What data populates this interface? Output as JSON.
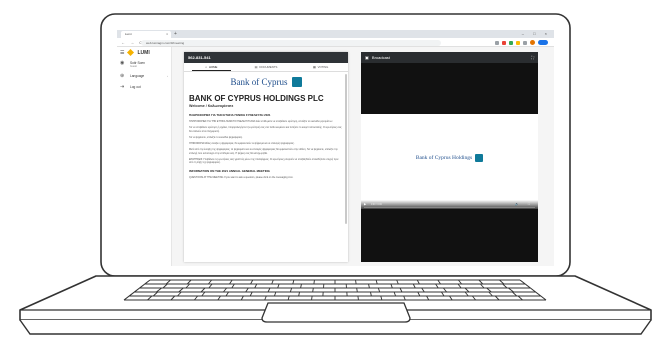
{
  "browser": {
    "tab_title": "Lumi",
    "tab_close": "×",
    "new_tab": "+",
    "window_controls": "–  □  ×",
    "nav_buttons": "← → C",
    "url": "web.lumiagm.com/#/meeting",
    "ext_icons": [
      "puzzle-icon",
      "star-icon",
      "extension-icon",
      "profile-icon",
      "update-icon"
    ]
  },
  "sidebar": {
    "menu_icon": "☰",
    "logo": "LUMI",
    "items": [
      {
        "icon": "◉",
        "icon_name": "user-icon",
        "label": "Sotir Soen",
        "sub": "Guest"
      },
      {
        "icon": "⊕",
        "icon_name": "globe-icon",
        "label": "Language",
        "chevron": "›"
      },
      {
        "icon": "⇥",
        "icon_name": "logout-icon",
        "label": "Log out"
      }
    ]
  },
  "meeting": {
    "header": "562-831-541",
    "tabs": [
      {
        "icon": "⌂",
        "icon_name": "home-icon",
        "label": "HOME"
      },
      {
        "icon": "▤",
        "icon_name": "documents-icon",
        "label": "DOCUMENTS"
      },
      {
        "icon": "▦",
        "icon_name": "voting-icon",
        "label": "VOTING"
      }
    ],
    "bank_name": "Bank of Cyprus",
    "title": "BANK OF CYPRUS HOLDINGS PLC",
    "subtitle": "Welcome / Καλωσορίσατε",
    "section1": "ΠΛΗΡΟΦΟΡΙΕΣ ΓΙΑ ΤΗΝ ΕΤΗΣΙΑ ΓΕΝΙΚΗ ΣΥΝΕΛΕΥΣΗ 2021",
    "paras": [
      "ΠΛΗΡΟΦΟΡΙΕΣ ΓΙΑ ΤΗΝ ΕΤΗΣΙΑ ΓΕΝΙΚΗ ΣΥΝΕΛΕΥΣΗ 2021 Εάν επιθυμείτε να υποβάλετε ερώτηση, επιλέξτε το εικονίδιο μηνυμάτων.",
      "Για να υποβάλετε ερώτηση ή σχόλιο, πληκτρολογήστε την ερώτησή σας στο πεδίο κειμένου και πατήστε το κουμπί αποστολής. Οι ερωτήσεις σας θα σταλούν στον διαχειριστή.",
      "Για να ψηφίσετε, επιλέξτε το εικονίδιο ψηφοφορίας.",
      "ΨΗΦΟΦΟΡΙΑ Μόλις ανοίξει η ψηφοφορία, θα εμφανιστούν οι ψήφισμα και οι επιλογές ψηφοφορίας.",
      "Μετά από την έναρξη της ψηφοφορίας, τα ψηφίσματα και οι επιλογές ψηφοφορίας θα εμφανιστούν στην οθόνη. Για να ψηφίσετε, επιλέξτε την επιλογή που αντιστοιχεί στην επιθυμία σας. Η ψήφος σας θα καταχωρηθεί.",
      "ΕΡΩΤΗΣΕΙΣ Υποβάλετε τις ερωτήσεις σας γραπτώς μέσω της πλατφόρμας. Οι ερωτήσεις μπορούν να υποβληθούν οποιαδήποτε στιγμή πριν από τη λήξη της ψηφοφορίας."
    ],
    "section2": "INFORMATION ON THE 2021 ANNUAL GENERAL MEETING",
    "para_en": "QUESTIONS AT THE MEETING If you want to ask a question, please click on the messaging icon."
  },
  "broadcast": {
    "icon": "▣",
    "title": "Broadcast",
    "expand_icon": "⛶",
    "video_logo": "Bank of Cyprus Holdings",
    "play": "▶",
    "time": "0:00 / 0:00",
    "right_controls": "🔊 ⛶"
  },
  "colors": {
    "brand_blue": "#1f4e8c",
    "brand_teal": "#0f7a9a",
    "lumi_yellow": "#f6b200",
    "header_dark": "#2f3337"
  }
}
